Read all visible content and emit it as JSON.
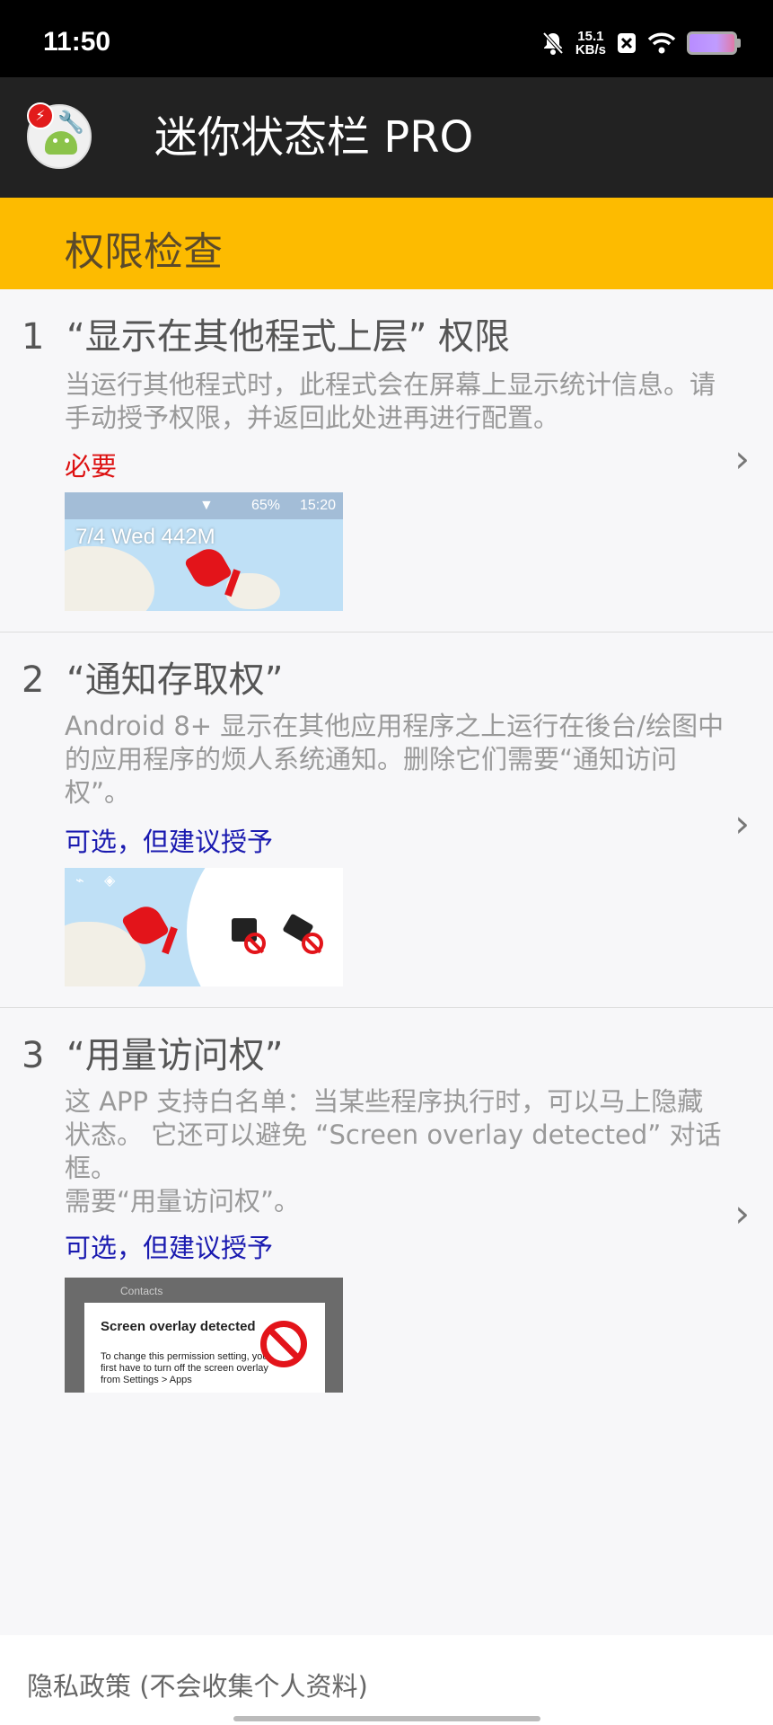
{
  "status_bar": {
    "time": "11:50",
    "net_speed_value": "15.1",
    "net_speed_unit": "KB/s",
    "icons": [
      "bell-off-icon",
      "x-box-icon",
      "wifi-icon",
      "battery-icon"
    ]
  },
  "app_bar": {
    "title": "迷你状态栏 PRO"
  },
  "section": {
    "title": "权限检查"
  },
  "permissions": [
    {
      "number": "1",
      "title": "“显示在其他程式上层” 权限",
      "description": "当运行其他程式时，此程式会在屏幕上显示统计信息。请手动授予权限，并返回此处进再进行配置。",
      "status": "必要",
      "thumb": {
        "bar_battery": "65%",
        "bar_time": "15:20",
        "overlay_text": "7/4    Wed    442M"
      }
    },
    {
      "number": "2",
      "title": "“通知存取权”",
      "description": "Android 8+ 显示在其他应用程序之上运行在後台/绘图中的应用程序的烦人系统通知。删除它们需要“通知访问权”。",
      "status": "可选，但建议授予"
    },
    {
      "number": "3",
      "title": "“用量访问权”",
      "description_line1": "这 APP 支持白名单：当某些程序执行时，可以马上隐藏状态。 它还可以避免 “Screen overlay detected” 对话框。",
      "description_line2": "需要“用量访问权”。",
      "status": "可选，但建议授予",
      "thumb": {
        "contacts_label": "Contacts",
        "dialog_title": "Screen overlay detected",
        "dialog_body": "To change this permission setting, you first have to turn off the screen overlay from Settings > Apps"
      }
    }
  ],
  "footer": {
    "privacy_label": "隐私政策 (不会收集个人资料)"
  },
  "colors": {
    "status_bar_bg": "#000000",
    "app_bar_bg": "#222222",
    "section_header_bg": "#fdbb00",
    "required_text": "#dd1111",
    "optional_text": "#1a1ab0"
  }
}
